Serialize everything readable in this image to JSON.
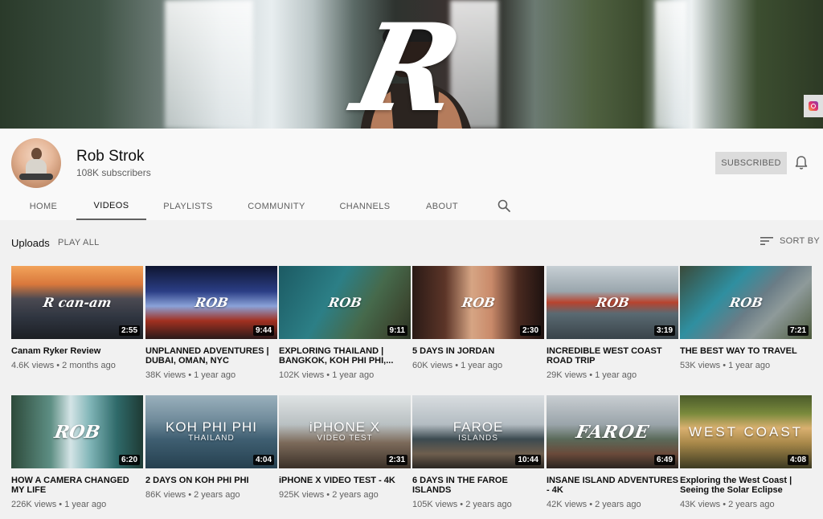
{
  "banner": {
    "logo_text": "R"
  },
  "channel": {
    "name": "Rob Strok",
    "subscribers": "108K subscribers",
    "subscribe_label": "SUBSCRIBED"
  },
  "tabs": [
    {
      "label": "HOME"
    },
    {
      "label": "VIDEOS"
    },
    {
      "label": "PLAYLISTS"
    },
    {
      "label": "COMMUNITY"
    },
    {
      "label": "CHANNELS"
    },
    {
      "label": "ABOUT"
    }
  ],
  "uploads": {
    "title": "Uploads",
    "play_all": "PLAY ALL",
    "sort_label": "SORT BY"
  },
  "videos": [
    {
      "title": "Canam Ryker Review",
      "meta": "4.6K views • 2 months ago",
      "duration": "2:55",
      "overlay": "R can-am",
      "bg": "linear-gradient(180deg,#f2a35a 0%,#d9783c 25%,#4b4a52 45%,#2f3540 70%,#1c1f24 100%)"
    },
    {
      "title": "UNPLANNED ADVENTURES | DUBAI, OMAN, NYC",
      "meta": "38K views • 1 year ago",
      "duration": "9:44",
      "overlay": "ROB",
      "bg": "linear-gradient(180deg,#0e1530 0%,#2b3e86 35%,#8aa2d8 55%,#a23020 75%,#2a1a1a 100%)"
    },
    {
      "title": "EXPLORING THAILAND | BANGKOK, KOH PHI PHI,...",
      "meta": "102K views • 1 year ago",
      "duration": "9:11",
      "overlay": "ROB",
      "bg": "linear-gradient(120deg,#1c5a63 0%,#2c7f86 40%,#466a4c 65%,#3d4b33 85%,#2a3324 100%)"
    },
    {
      "title": "5 DAYS IN JORDAN",
      "meta": "60K views • 1 year ago",
      "duration": "2:30",
      "overlay": "ROB",
      "bg": "linear-gradient(90deg,#2a1a16 0%,#5c3528 25%,#d6a584 45%,#c98a6a 60%,#4a2a20 80%,#1e1210 100%)"
    },
    {
      "title": "INCREDIBLE WEST COAST ROAD TRIP",
      "meta": "29K views • 1 year ago",
      "duration": "3:19",
      "overlay": "ROB",
      "bg": "linear-gradient(180deg,#c7cfd4 0%,#9aa6ad 35%,#b8432e 50%,#5a6a72 65%,#394349 100%)"
    },
    {
      "title": "THE BEST WAY TO TRAVEL",
      "meta": "53K views • 1 year ago",
      "duration": "7:21",
      "overlay": "ROB",
      "bg": "linear-gradient(135deg,#3a4a3a 0%,#2f8fa0 35%,#6a7c86 55%,#8e9a9a 70%,#4c5a3c 100%)"
    },
    {
      "title": "HOW A CAMERA CHANGED MY LIFE",
      "meta": "226K views • 1 year ago",
      "duration": "6:20",
      "overlay": "ROB",
      "bg": "linear-gradient(90deg,#2d4a3a 0%,#5e8f84 30%,#d4e4e6 45%,#7fb4b6 60%,#2f6a6a 80%,#1e3a34 100%)"
    },
    {
      "title": "2 DAYS ON KOH PHI PHI",
      "meta": "86K views • 2 years ago",
      "duration": "4:04",
      "overlay_title": "KOH PHI PHI",
      "overlay_sub": "THAILAND",
      "bg": "linear-gradient(180deg,#9ab0bc 0%,#6f8a9a 35%,#3f5f72 60%,#26404f 100%)"
    },
    {
      "title": "iPHONE X VIDEO TEST - 4K",
      "meta": "925K views • 2 years ago",
      "duration": "2:31",
      "overlay_title": "iPHONE X",
      "overlay_sub": "VIDEO TEST",
      "bg": "linear-gradient(180deg,#dfe3e4 0%,#b9c0c2 40%,#7c6a5a 65%,#3a3028 100%)"
    },
    {
      "title": "6 DAYS IN THE FAROE ISLANDS",
      "meta": "105K views • 2 years ago",
      "duration": "10:44",
      "overlay_title": "FAROE",
      "overlay_sub": "ISLANDS",
      "bg": "linear-gradient(180deg,#d9dde0 0%,#b3bcc2 40%,#3c4a50 60%,#6e5e4e 80%,#2a2622 100%)"
    },
    {
      "title": "INSANE ISLAND ADVENTURES - 4K",
      "meta": "42K views • 2 years ago",
      "duration": "6:49",
      "overlay": "FAROE",
      "bg": "linear-gradient(180deg,#c9ced2 0%,#9aa4aa 40%,#5a6a5a 60%,#6a4a3a 80%,#2a2420 100%)"
    },
    {
      "title": "Exploring the West Coast | Seeing the Solar Eclipse",
      "meta": "43K views • 2 years ago",
      "duration": "4:08",
      "overlay_title": "WEST COAST",
      "bg": "linear-gradient(180deg,#4a5a2a 0%,#7a8a3c 25%,#d9b070 45%,#a9894a 65%,#3c3a22 100%)"
    }
  ],
  "colors": {
    "accent_text": "#606060",
    "background": "#f1f1f1"
  }
}
